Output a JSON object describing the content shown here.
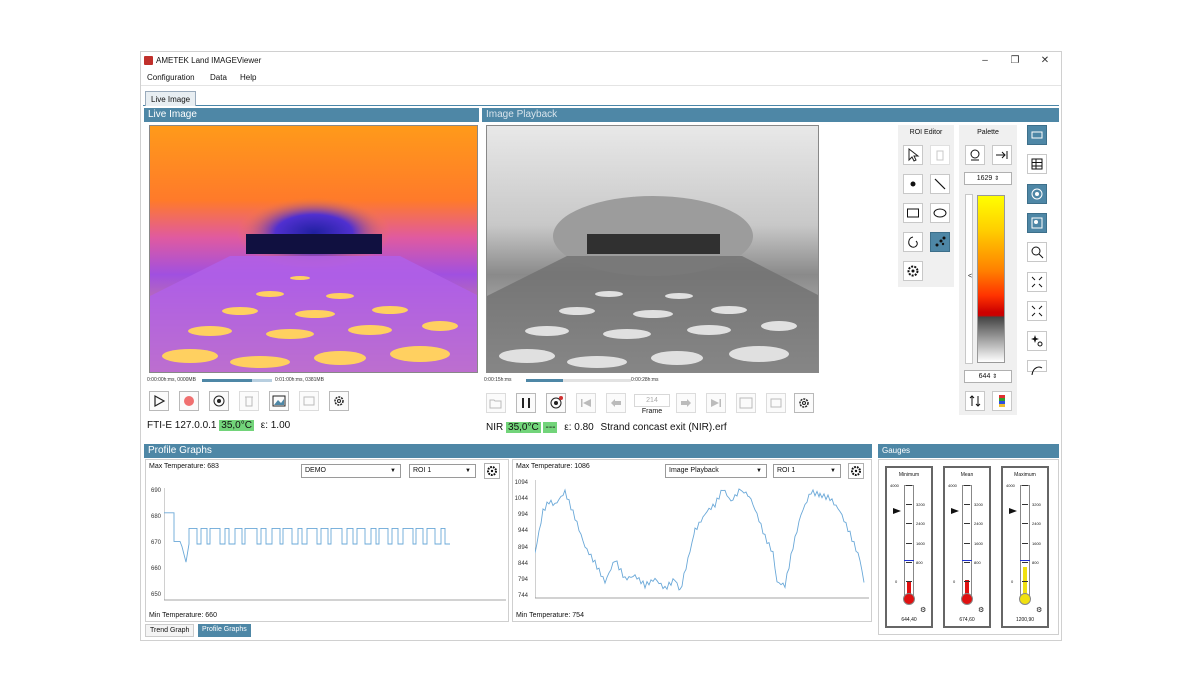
{
  "window": {
    "title": "AMETEK Land IMAGEViewer",
    "controls": [
      "minimize",
      "restore",
      "close"
    ]
  },
  "menu": [
    "Configuration",
    "Data",
    "Help"
  ],
  "top_tab": "Live Image",
  "live_panel": {
    "title": "Live Image",
    "time_start": "0:00:00h:ms, 0000MB",
    "time_end": "0:01:00h:ms, 0381MB",
    "progress": 0.72,
    "camera": "FTI-E 127.0.0.1",
    "temp": "35,0°C",
    "emissivity": "ε: 1.00"
  },
  "playback_panel": {
    "title": "Image Playback",
    "time_start": "0:00:15h:ms",
    "time_end": "0:00:28h:ms",
    "progress": 0.35,
    "frame_value": "214",
    "frame_label": "Frame",
    "camera": "NIR",
    "temp": "35,0°C",
    "placeholder": "---",
    "emissivity": "ε: 0.80",
    "filename": "Strand concast exit (NIR).erf"
  },
  "roi_editor": {
    "title": "ROI Editor",
    "icons": [
      "pointer-icon",
      "trash-icon",
      "point-icon",
      "line-icon",
      "rectangle-icon",
      "ellipse-icon",
      "polygon-icon",
      "auto-roi-icon",
      "gear-icon"
    ]
  },
  "palette": {
    "title": "Palette",
    "max_value": "1629",
    "min_value": "644",
    "collapse": "<",
    "colors": [
      "#ffff00",
      "#ffd000",
      "#ff8000",
      "#ff3300",
      "#cc0000",
      "#444444",
      "#ffffff"
    ]
  },
  "right_toolbar": [
    "window-icon",
    "table-icon",
    "palette-icon",
    "zoom-region-icon",
    "zoom-search-icon",
    "shrink-icon",
    "expand-icon",
    "sparkle-icon",
    "curve-icon"
  ],
  "profile_graphs": {
    "title": "Profile Graphs",
    "left": {
      "max_label": "Max Temperature: 683",
      "min_label": "Min Temperature: 660",
      "source": "DEMO",
      "roi": "ROI 1",
      "yticks": [
        "690",
        "680",
        "670",
        "660",
        "650"
      ]
    },
    "right": {
      "max_label": "Max Temperature: 1086",
      "min_label": "Min Temperature: 754",
      "source": "Image Playback",
      "roi": "ROI 1",
      "yticks": [
        "1094",
        "1044",
        "994",
        "944",
        "894",
        "844",
        "794",
        "744"
      ]
    },
    "bottom_tabs": [
      "Trend Graph",
      "Profile Graphs"
    ]
  },
  "gauges": {
    "title": "Gauges",
    "items": [
      {
        "title": "Minimum",
        "value": "644,40",
        "fill": 0.161,
        "color": "#e01010",
        "ticks": [
          "4000",
          "3200",
          "2400",
          "1600",
          "800",
          "0"
        ]
      },
      {
        "title": "Mean",
        "value": "674,60",
        "fill": 0.169,
        "color": "#e01010",
        "ticks": [
          "4000",
          "3200",
          "2400",
          "1600",
          "800",
          "0"
        ]
      },
      {
        "title": "Maximum",
        "value": "1200,90",
        "fill": 0.3,
        "color": "#f0e010",
        "ticks": [
          "4000",
          "3200",
          "2400",
          "1600",
          "800",
          "0"
        ]
      }
    ]
  }
}
